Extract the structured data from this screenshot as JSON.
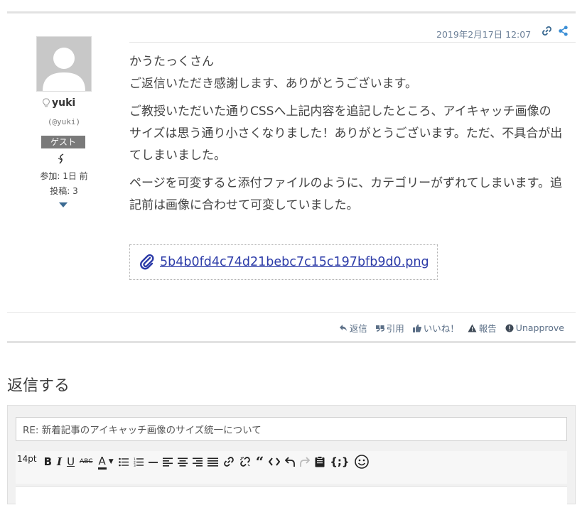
{
  "post": {
    "date": "2019年2月17日 12:07",
    "author": {
      "name": "yuki",
      "handle": "(@yuki)",
      "role": "ゲスト",
      "joined": "参加: 1日 前",
      "posts": "投稿: 3"
    },
    "body": {
      "p1": "かうたっくさん",
      "p2": "ご返信いただき感謝します、ありがとうございます。",
      "p3": "ご教授いただいた通りCSSへ上記内容を追記したところ、アイキャッチ画像のサイズは思う通り小さくなりました！ありがとうございます。ただ、不具合が出てしまいました。",
      "p4": "ページを可変すると添付ファイルのように、カテゴリーがずれてしまいます。追記前は画像に合わせて可変していました。"
    },
    "attachment": "5b4b0fd4c74d21bebc7c15c197bfb9d0.png",
    "actions": {
      "reply": "返信",
      "quote": "引用",
      "like": "いいね！",
      "report": "報告",
      "unapprove": "Unapprove"
    }
  },
  "reply_form": {
    "heading": "返信する",
    "title_value": "RE: 新着記事のアイキャッチ画像のサイズ統一について",
    "font_size": "14pt"
  },
  "colors": {
    "accent": "#3b6a92",
    "link": "#2c3ba8",
    "badge": "#7a7a7a"
  }
}
